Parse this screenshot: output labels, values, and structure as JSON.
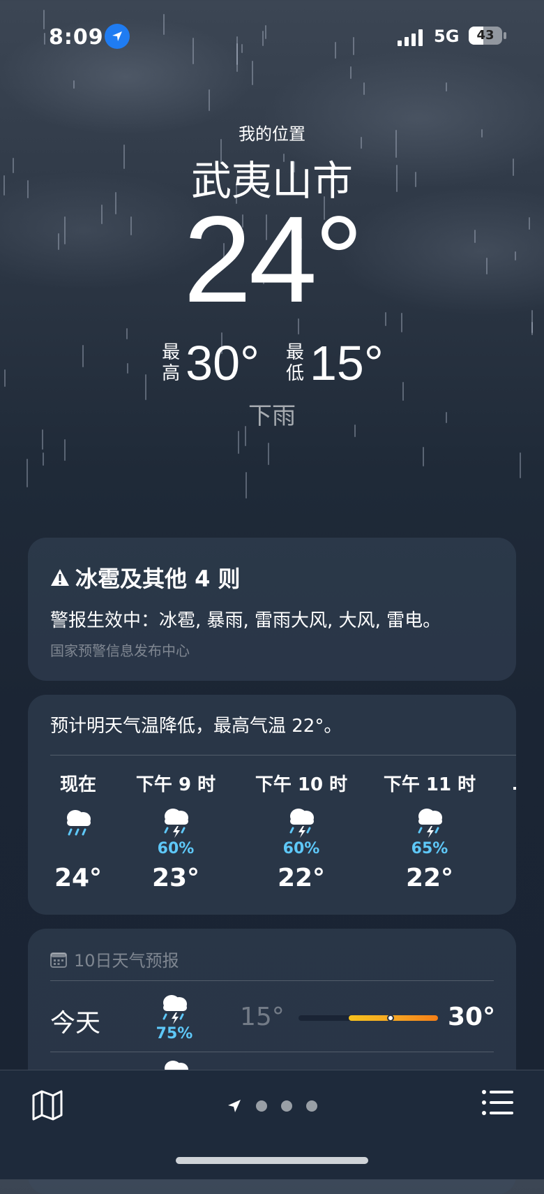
{
  "status_bar": {
    "time": "8:09",
    "network": "5G",
    "battery": "43",
    "battery_fraction": 0.43
  },
  "hero": {
    "location_label": "我的位置",
    "city": "武夷山市",
    "temperature": "24°",
    "high_label": "最高",
    "high": "30°",
    "low_label": "最低",
    "low": "15°",
    "condition": "下雨"
  },
  "alert": {
    "title": "冰雹及其他 4 则",
    "body": "警报生效中：冰雹, 暴雨, 雷雨大风, 大风, 雷电。",
    "source": "国家预警信息发布中心"
  },
  "hourly": {
    "summary": "预计明天气温降低，最高气温 22°。",
    "items": [
      {
        "label": "现在",
        "icon": "rain-icon",
        "pct": "",
        "temp": "24°"
      },
      {
        "label": "下午 9 时",
        "icon": "thunderstorm-icon",
        "pct": "60%",
        "temp": "23°"
      },
      {
        "label": "下午 10 时",
        "icon": "thunderstorm-icon",
        "pct": "60%",
        "temp": "22°"
      },
      {
        "label": "下午 11 时",
        "icon": "thunderstorm-icon",
        "pct": "65%",
        "temp": "22°"
      }
    ]
  },
  "forecast": {
    "header": "10日天气预报",
    "days": [
      {
        "day": "今天",
        "icon": "thunderstorm-icon",
        "pct": "75%",
        "low": "15°",
        "high": "30°",
        "range_start": 0.36,
        "range_end": 1.0,
        "current": 0.66
      }
    ]
  },
  "colors": {
    "accent_blue": "#1f7cf2",
    "precip_blue": "#5ec8f8",
    "temp_bar_start": "#f7c21d",
    "temp_bar_end": "#f57f17"
  }
}
